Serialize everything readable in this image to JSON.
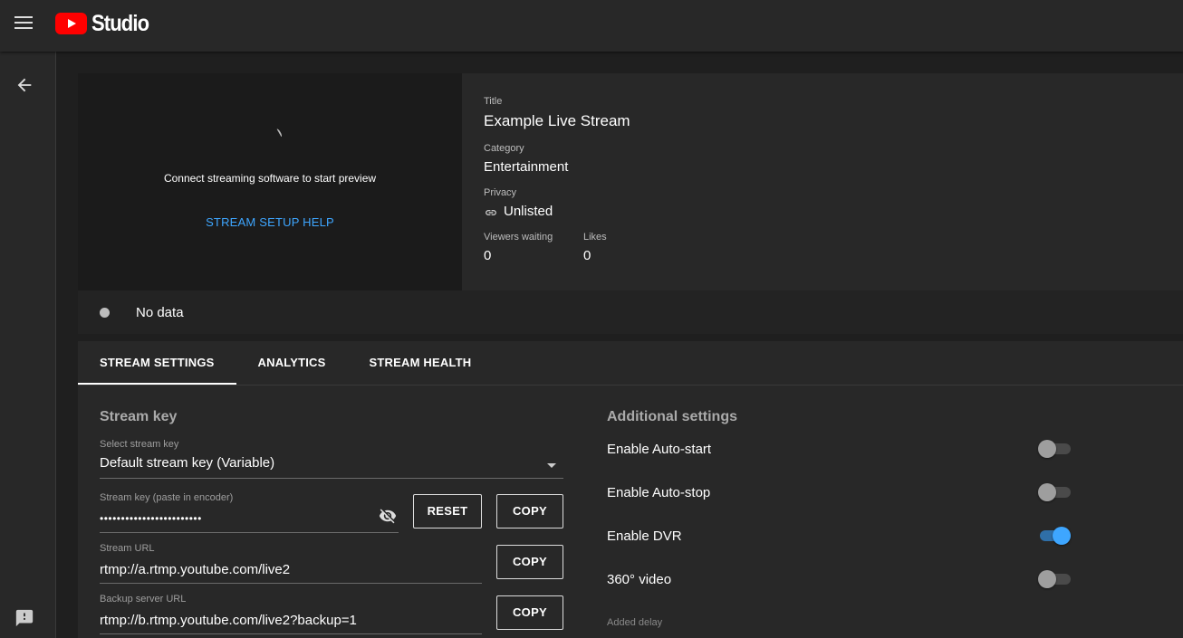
{
  "header": {
    "app_name": "Studio",
    "menu_icon": "hamburger-menu-icon",
    "logo_icon": "youtube-play-icon"
  },
  "rail": {
    "back_icon": "arrow-left-icon",
    "feedback_icon": "feedback-icon"
  },
  "preview": {
    "message": "Connect streaming software to start preview",
    "help_link": "STREAM SETUP HELP"
  },
  "info": {
    "title_label": "Title",
    "title_value": "Example Live Stream",
    "category_label": "Category",
    "category_value": "Entertainment",
    "privacy_label": "Privacy",
    "privacy_value": "Unlisted",
    "privacy_icon": "link-icon",
    "viewers_label": "Viewers waiting",
    "viewers_value": "0",
    "likes_label": "Likes",
    "likes_value": "0"
  },
  "status": {
    "text": "No data"
  },
  "tabs": [
    {
      "label": "STREAM SETTINGS",
      "active": true
    },
    {
      "label": "ANALYTICS",
      "active": false
    },
    {
      "label": "STREAM HEALTH",
      "active": false
    }
  ],
  "stream_key": {
    "section_title": "Stream key",
    "select_label": "Select stream key",
    "select_value": "Default stream key (Variable)",
    "key_label": "Stream key (paste in encoder)",
    "key_value": "••••••••••••••••••••••••",
    "visibility_icon": "eye-off-icon",
    "reset_label": "RESET",
    "copy_label": "COPY",
    "url_label": "Stream URL",
    "url_value": "rtmp://a.rtmp.youtube.com/live2",
    "backup_label": "Backup server URL",
    "backup_value": "rtmp://b.rtmp.youtube.com/live2?backup=1"
  },
  "additional": {
    "section_title": "Additional settings",
    "settings": [
      {
        "label": "Enable Auto-start",
        "on": false
      },
      {
        "label": "Enable Auto-stop",
        "on": false
      },
      {
        "label": "Enable DVR",
        "on": true
      },
      {
        "label": "360° video",
        "on": false
      }
    ],
    "delay_label": "Added delay"
  },
  "colors": {
    "accent": "#3ea6ff",
    "brand": "#ff0000",
    "background": "#1f1f1f",
    "surface": "#282828"
  }
}
